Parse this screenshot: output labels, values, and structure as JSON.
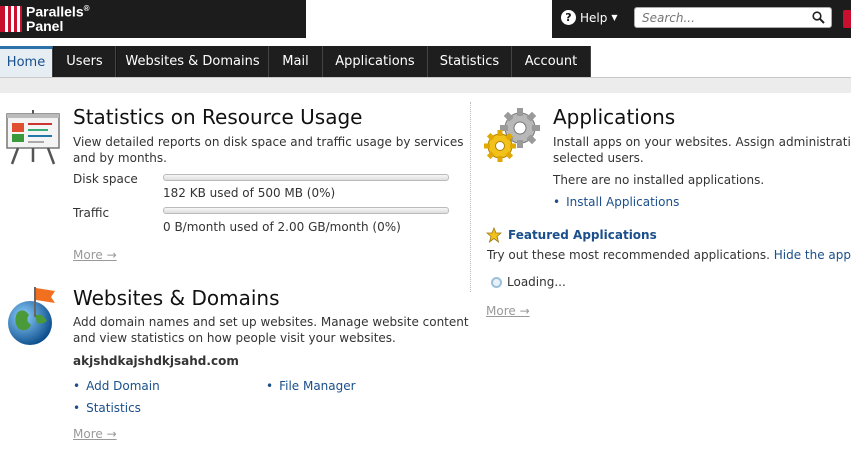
{
  "brand": {
    "line1": "Parallels",
    "reg": "®",
    "line2": "Panel"
  },
  "header": {
    "help_label": "Help",
    "search_placeholder": "Search..."
  },
  "nav": {
    "tabs": [
      {
        "label": "Home"
      },
      {
        "label": "Users"
      },
      {
        "label": "Websites & Domains"
      },
      {
        "label": "Mail"
      },
      {
        "label": "Applications"
      },
      {
        "label": "Statistics"
      },
      {
        "label": "Account"
      }
    ]
  },
  "stats": {
    "title": "Statistics on Resource Usage",
    "desc1": "View detailed reports on disk space and traffic usage by services",
    "desc2": "and by months.",
    "disk_label": "Disk space",
    "disk_usage": "182 KB used of 500 MB (0%)",
    "disk_fraction": 0,
    "traffic_label": "Traffic",
    "traffic_usage": "0 B/month used of 2.00 GB/month (0%)",
    "traffic_fraction": 0,
    "more": "More →"
  },
  "websites": {
    "title": "Websites & Domains",
    "desc1": "Add domain names and set up websites. Manage website content",
    "desc2": "and view statistics on how people visit your websites.",
    "domain": "akjshdkajshdkjsahd.com",
    "add_domain": "Add Domain",
    "file_manager": "File Manager",
    "statistics": "Statistics",
    "more": "More →"
  },
  "applications": {
    "title": "Applications",
    "desc1": "Install apps on your websites. Assign administrativ",
    "desc2": "selected users.",
    "none_installed": "There are no installed applications.",
    "install_link": "Install Applications",
    "featured_title": "Featured Applications",
    "featured_desc": "Try out these most recommended applications.",
    "hide_link": "Hide the apps.",
    "loading": "Loading...",
    "more": "More →"
  },
  "colors": {
    "link": "#1a4f8b",
    "nav_bg": "#1c1c1c",
    "brand_red": "#c8102e"
  }
}
